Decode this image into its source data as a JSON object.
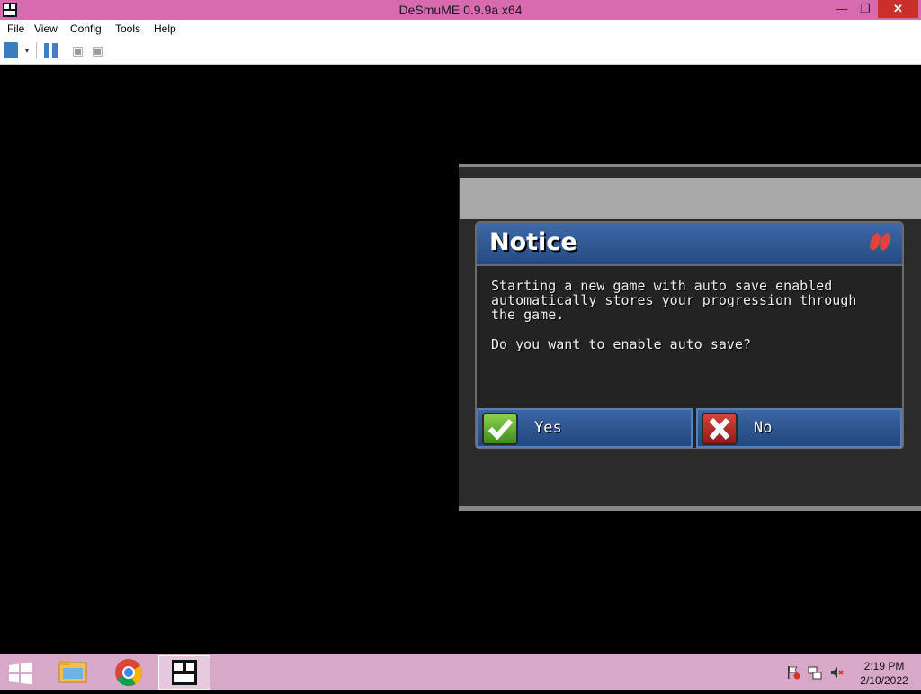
{
  "window": {
    "title": "DeSmuME 0.9.9a x64",
    "app_icon_text": "des\nmu",
    "minimize_glyph": "—",
    "restore_glyph": "❐",
    "close_glyph": "✕"
  },
  "menu": {
    "items": [
      "File",
      "View",
      "Config",
      "Tools",
      "Help"
    ]
  },
  "toolbar": {
    "icons": [
      "open-rom-icon",
      "dropdown-arrow-icon",
      "pause-icon",
      "memory-icon",
      "memory-icon"
    ],
    "dropdown_glyph": "▾",
    "mem_glyph": "▣"
  },
  "dialog": {
    "title": "Notice",
    "body": "Starting a new game with auto save enabled automatically stores your progression through the game.",
    "question": "Do you want to enable auto save?",
    "yes_label": "Yes",
    "no_label": "No",
    "colors": {
      "header": "#2f5a96",
      "body": "#232323",
      "yes_icon": "#5fb030",
      "no_icon": "#c0302a"
    }
  },
  "taskbar": {
    "apps": [
      "windows-start-icon",
      "file-explorer-icon",
      "chrome-icon",
      "desmume-icon"
    ],
    "tray": [
      "action-center-flag-icon",
      "network-icon",
      "volume-muted-icon"
    ],
    "time": "2:19 PM",
    "date": "2/10/2022"
  }
}
